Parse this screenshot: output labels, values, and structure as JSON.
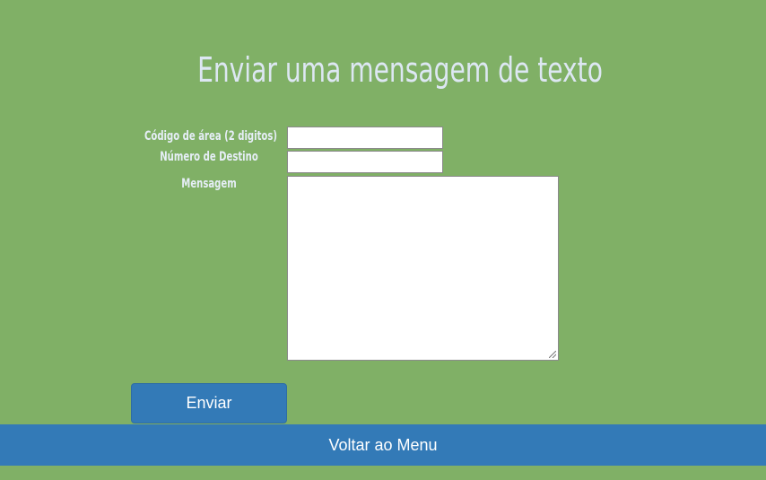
{
  "page": {
    "title": "Enviar uma mensagem de texto"
  },
  "form": {
    "area_code_label": "Código de área (2 digitos)",
    "area_code_value": "",
    "destination_label": "Número de Destino",
    "destination_value": "",
    "message_label": "Mensagem",
    "message_value": ""
  },
  "actions": {
    "send_label": "Enviar",
    "back_label": "Voltar ao Menu"
  },
  "colors": {
    "background": "#80b066",
    "button": "#337ab7",
    "title_text": "#dde7f3"
  }
}
